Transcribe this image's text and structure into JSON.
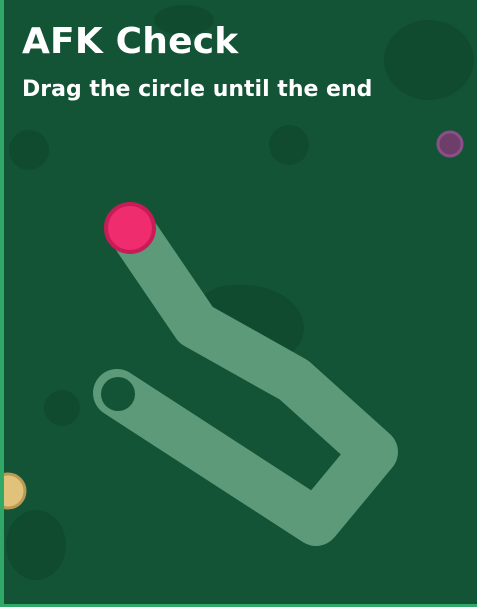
{
  "game": {
    "title": "AFK Check",
    "instruction": "Drag the circle until the end"
  },
  "colors": {
    "background": "#145436",
    "border": "#2fa868",
    "path": "#5d9a79",
    "drag_circle": "#ef2c6e",
    "drag_circle_ring": "#c81b57",
    "end_hole": "#145436",
    "purple_orb": "#6e3e6a",
    "tan_orb": "#e0c27a"
  }
}
